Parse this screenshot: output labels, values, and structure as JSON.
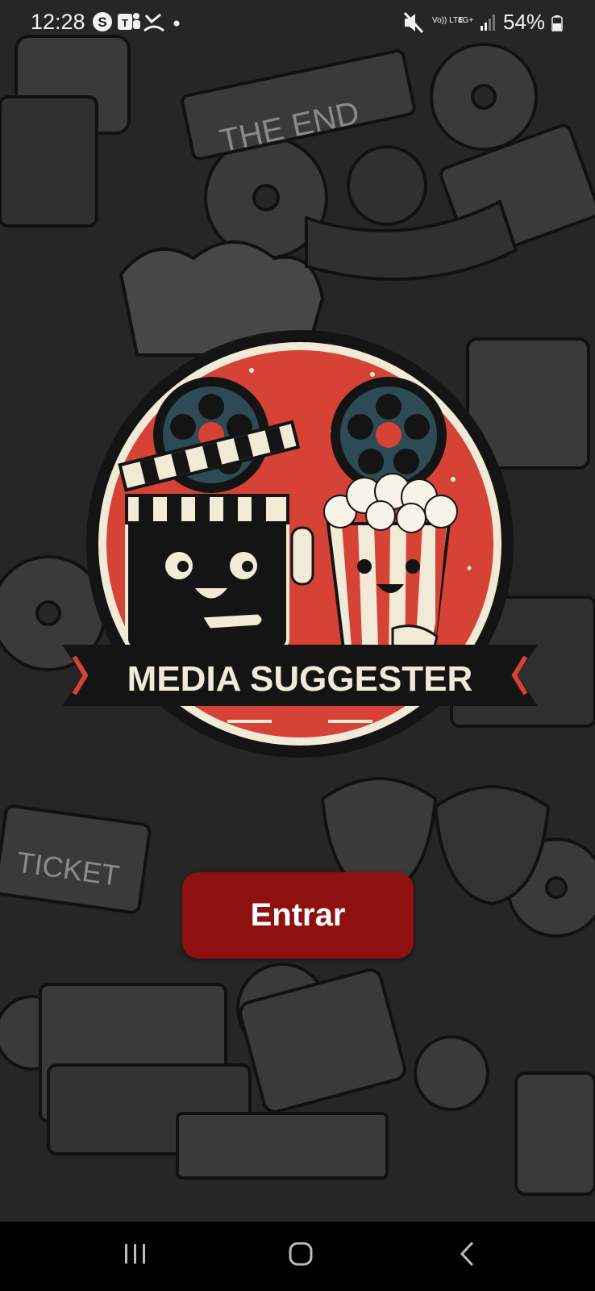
{
  "status_bar": {
    "time": "12:28",
    "battery_percent": "54%",
    "network_label_1": "Vo)) LTE",
    "network_label_2": "4G+",
    "battery_level": 0.54,
    "app_icons": [
      "skype-icon",
      "teams-icon",
      "missed-call-icon",
      "notification-dot-icon"
    ],
    "system_icons": [
      "mute-icon",
      "volte-icon",
      "4g-data-icon",
      "signal-icon",
      "battery-icon"
    ]
  },
  "logo": {
    "title": "MEDIA SUGGESTER",
    "colors": {
      "red": "#d64235",
      "black": "#141414",
      "cream": "#f1ead7"
    }
  },
  "main": {
    "enter_label": "Entrar",
    "enter_color": "#8e1010"
  },
  "background": {
    "doodle_texts": [
      "THE END",
      "TICKET"
    ]
  },
  "nav_bar": {
    "buttons": [
      "recent-apps-icon",
      "home-icon",
      "back-icon"
    ]
  }
}
